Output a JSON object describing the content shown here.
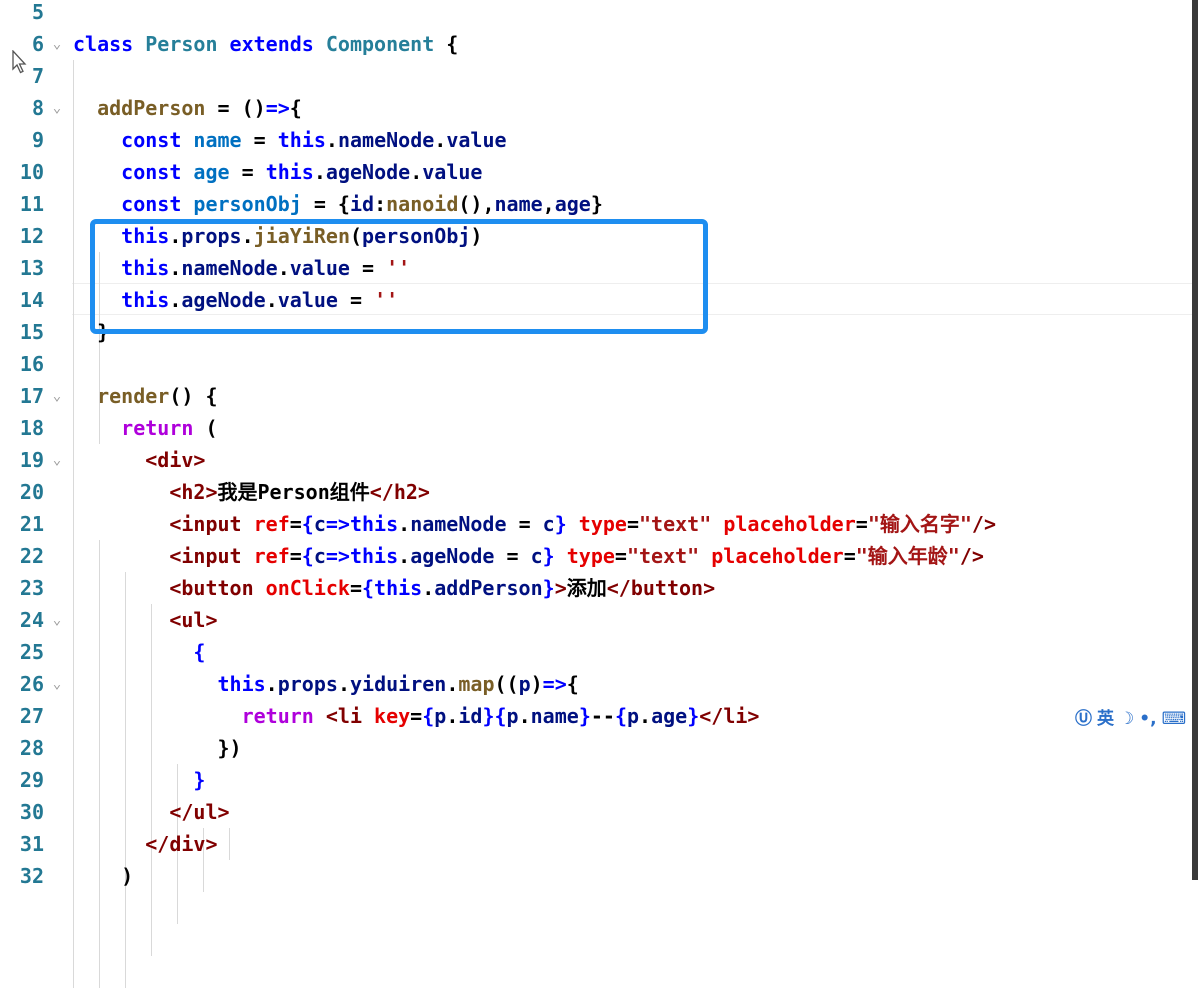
{
  "editor": {
    "lines": [
      {
        "num": "5",
        "fold": "",
        "tokens": []
      },
      {
        "num": "6",
        "fold": "⌄",
        "tokens": [
          [
            "kw",
            "class "
          ],
          [
            "cls",
            "Person "
          ],
          [
            "kw",
            "extends "
          ],
          [
            "cls",
            "Component "
          ],
          [
            "plain",
            "{"
          ]
        ]
      },
      {
        "num": "7",
        "fold": "",
        "tokens": []
      },
      {
        "num": "8",
        "fold": "⌄",
        "tokens": [
          [
            "plain",
            "  "
          ],
          [
            "fn",
            "addPerson "
          ],
          [
            "plain",
            "= ()"
          ],
          [
            "kw",
            "=>"
          ],
          [
            "plain",
            "{"
          ]
        ]
      },
      {
        "num": "9",
        "fold": "",
        "tokens": [
          [
            "plain",
            "    "
          ],
          [
            "kw",
            "const "
          ],
          [
            "const",
            "name "
          ],
          [
            "plain",
            "= "
          ],
          [
            "kw",
            "this"
          ],
          [
            "plain",
            "."
          ],
          [
            "var",
            "nameNode"
          ],
          [
            "plain",
            "."
          ],
          [
            "var",
            "value"
          ]
        ]
      },
      {
        "num": "10",
        "fold": "",
        "tokens": [
          [
            "plain",
            "    "
          ],
          [
            "kw",
            "const "
          ],
          [
            "const",
            "age "
          ],
          [
            "plain",
            "= "
          ],
          [
            "kw",
            "this"
          ],
          [
            "plain",
            "."
          ],
          [
            "var",
            "ageNode"
          ],
          [
            "plain",
            "."
          ],
          [
            "var",
            "value"
          ]
        ]
      },
      {
        "num": "11",
        "fold": "",
        "tokens": [
          [
            "plain",
            "    "
          ],
          [
            "kw",
            "const "
          ],
          [
            "const",
            "personObj "
          ],
          [
            "plain",
            "= {"
          ],
          [
            "var",
            "id"
          ],
          [
            "plain",
            ":"
          ],
          [
            "fn",
            "nanoid"
          ],
          [
            "plain",
            "(),"
          ],
          [
            "var",
            "name"
          ],
          [
            "plain",
            ","
          ],
          [
            "var",
            "age"
          ],
          [
            "plain",
            "}"
          ]
        ]
      },
      {
        "num": "12",
        "fold": "",
        "tokens": [
          [
            "plain",
            "    "
          ],
          [
            "kw",
            "this"
          ],
          [
            "plain",
            "."
          ],
          [
            "var",
            "props"
          ],
          [
            "plain",
            "."
          ],
          [
            "fn",
            "jiaYiRen"
          ],
          [
            "plain",
            "("
          ],
          [
            "var",
            "personObj"
          ],
          [
            "plain",
            ")"
          ]
        ]
      },
      {
        "num": "13",
        "fold": "",
        "tokens": [
          [
            "plain",
            "    "
          ],
          [
            "kw",
            "this"
          ],
          [
            "plain",
            "."
          ],
          [
            "var",
            "nameNode"
          ],
          [
            "plain",
            "."
          ],
          [
            "var",
            "value "
          ],
          [
            "plain",
            "= "
          ],
          [
            "str",
            "''"
          ]
        ]
      },
      {
        "num": "14",
        "fold": "",
        "tokens": [
          [
            "plain",
            "    "
          ],
          [
            "kw",
            "this"
          ],
          [
            "plain",
            "."
          ],
          [
            "var",
            "ageNode"
          ],
          [
            "plain",
            "."
          ],
          [
            "var",
            "value "
          ],
          [
            "plain",
            "= "
          ],
          [
            "str",
            "''"
          ]
        ]
      },
      {
        "num": "15",
        "fold": "",
        "tokens": [
          [
            "plain",
            "  }"
          ]
        ]
      },
      {
        "num": "16",
        "fold": "",
        "tokens": []
      },
      {
        "num": "17",
        "fold": "⌄",
        "tokens": [
          [
            "plain",
            "  "
          ],
          [
            "fn",
            "render"
          ],
          [
            "plain",
            "() {"
          ]
        ]
      },
      {
        "num": "18",
        "fold": "",
        "tokens": [
          [
            "plain",
            "    "
          ],
          [
            "ctrl",
            "return "
          ],
          [
            "plain",
            "("
          ]
        ]
      },
      {
        "num": "19",
        "fold": "⌄",
        "tokens": [
          [
            "plain",
            "      "
          ],
          [
            "tag",
            "<div>"
          ]
        ]
      },
      {
        "num": "20",
        "fold": "",
        "tokens": [
          [
            "plain",
            "        "
          ],
          [
            "tag",
            "<h2>"
          ],
          [
            "plain",
            "我是Person组件"
          ],
          [
            "tag",
            "</h2>"
          ]
        ]
      },
      {
        "num": "21",
        "fold": "",
        "tokens": [
          [
            "plain",
            "        "
          ],
          [
            "tag",
            "<input "
          ],
          [
            "attr",
            "ref"
          ],
          [
            "plain",
            "="
          ],
          [
            "kw",
            "{"
          ],
          [
            "var",
            "c"
          ],
          [
            "kw",
            "=>this"
          ],
          [
            "plain",
            "."
          ],
          [
            "var",
            "nameNode "
          ],
          [
            "plain",
            "= "
          ],
          [
            "var",
            "c"
          ],
          [
            "kw",
            "} "
          ],
          [
            "attr",
            "type"
          ],
          [
            "plain",
            "="
          ],
          [
            "str",
            "\"text\" "
          ],
          [
            "attr",
            "placeholder"
          ],
          [
            "plain",
            "="
          ],
          [
            "str",
            "\"输入名字\""
          ],
          [
            "tag",
            "/>"
          ]
        ]
      },
      {
        "num": "22",
        "fold": "",
        "tokens": [
          [
            "plain",
            "        "
          ],
          [
            "tag",
            "<input "
          ],
          [
            "attr",
            "ref"
          ],
          [
            "plain",
            "="
          ],
          [
            "kw",
            "{"
          ],
          [
            "var",
            "c"
          ],
          [
            "kw",
            "=>this"
          ],
          [
            "plain",
            "."
          ],
          [
            "var",
            "ageNode "
          ],
          [
            "plain",
            "= "
          ],
          [
            "var",
            "c"
          ],
          [
            "kw",
            "} "
          ],
          [
            "attr",
            "type"
          ],
          [
            "plain",
            "="
          ],
          [
            "str",
            "\"text\" "
          ],
          [
            "attr",
            "placeholder"
          ],
          [
            "plain",
            "="
          ],
          [
            "str",
            "\"输入年龄\""
          ],
          [
            "tag",
            "/>"
          ]
        ]
      },
      {
        "num": "23",
        "fold": "",
        "tokens": [
          [
            "plain",
            "        "
          ],
          [
            "tag",
            "<button "
          ],
          [
            "attr",
            "onClick"
          ],
          [
            "plain",
            "="
          ],
          [
            "kw",
            "{this"
          ],
          [
            "plain",
            "."
          ],
          [
            "var",
            "addPerson"
          ],
          [
            "kw",
            "}"
          ],
          [
            "tag",
            ">"
          ],
          [
            "plain",
            "添加"
          ],
          [
            "tag",
            "</button>"
          ]
        ]
      },
      {
        "num": "24",
        "fold": "⌄",
        "tokens": [
          [
            "plain",
            "        "
          ],
          [
            "tag",
            "<ul>"
          ]
        ]
      },
      {
        "num": "25",
        "fold": "",
        "tokens": [
          [
            "plain",
            "          "
          ],
          [
            "kw",
            "{"
          ]
        ]
      },
      {
        "num": "26",
        "fold": "⌄",
        "tokens": [
          [
            "plain",
            "            "
          ],
          [
            "kw",
            "this"
          ],
          [
            "plain",
            "."
          ],
          [
            "var",
            "props"
          ],
          [
            "plain",
            "."
          ],
          [
            "var",
            "yiduiren"
          ],
          [
            "plain",
            "."
          ],
          [
            "fn",
            "map"
          ],
          [
            "plain",
            "(("
          ],
          [
            "var",
            "p"
          ],
          [
            "plain",
            ")"
          ],
          [
            "kw",
            "=>"
          ],
          [
            "plain",
            "{"
          ]
        ]
      },
      {
        "num": "27",
        "fold": "",
        "tokens": [
          [
            "plain",
            "              "
          ],
          [
            "ctrl",
            "return "
          ],
          [
            "tag",
            "<li "
          ],
          [
            "attr",
            "key"
          ],
          [
            "plain",
            "="
          ],
          [
            "kw",
            "{"
          ],
          [
            "var",
            "p"
          ],
          [
            "plain",
            "."
          ],
          [
            "var",
            "id"
          ],
          [
            "kw",
            "}{"
          ],
          [
            "var",
            "p"
          ],
          [
            "plain",
            "."
          ],
          [
            "var",
            "name"
          ],
          [
            "kw",
            "}"
          ],
          [
            "plain",
            "--"
          ],
          [
            "kw",
            "{"
          ],
          [
            "var",
            "p"
          ],
          [
            "plain",
            "."
          ],
          [
            "var",
            "age"
          ],
          [
            "kw",
            "}"
          ],
          [
            "tag",
            "</li>"
          ]
        ]
      },
      {
        "num": "28",
        "fold": "",
        "tokens": [
          [
            "plain",
            "            })"
          ]
        ]
      },
      {
        "num": "29",
        "fold": "",
        "tokens": [
          [
            "plain",
            "          "
          ],
          [
            "kw",
            "}"
          ]
        ]
      },
      {
        "num": "30",
        "fold": "",
        "tokens": [
          [
            "plain",
            "        "
          ],
          [
            "tag",
            "</ul>"
          ]
        ]
      },
      {
        "num": "31",
        "fold": "",
        "tokens": [
          [
            "plain",
            "      "
          ],
          [
            "tag",
            "</div>"
          ]
        ]
      },
      {
        "num": "32",
        "fold": "",
        "tokens": [
          [
            "plain",
            "    )"
          ]
        ]
      }
    ]
  },
  "ime": {
    "logo": "Ⓤ",
    "lang": "英",
    "moon": "☽",
    "punct": "•,",
    "keyboard": "⌨"
  },
  "colors": {
    "line_number": "#237893",
    "highlight": "#1e8ef0",
    "keyword": "#0000ff",
    "tag": "#800000",
    "attribute": "#e50000",
    "string": "#a31515"
  }
}
